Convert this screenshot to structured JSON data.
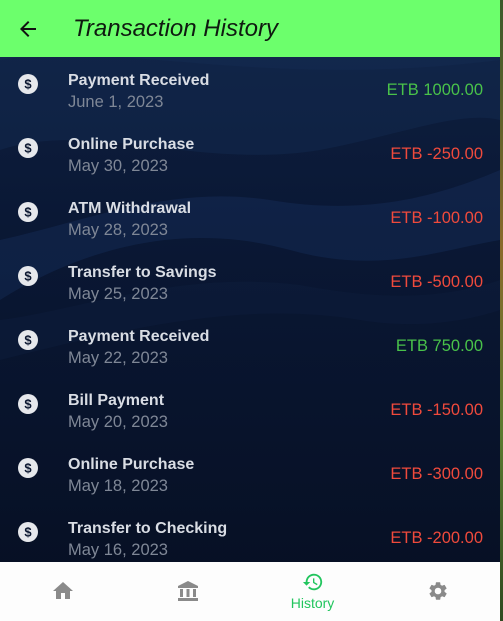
{
  "appbar": {
    "title": "Transaction History",
    "background": "#6cff6c",
    "back_icon": "arrow-back-icon"
  },
  "transactions": [
    {
      "title": "Payment Received",
      "date": "June 1, 2023",
      "amount": "ETB 1000.00",
      "type": "credit"
    },
    {
      "title": "Online Purchase",
      "date": "May 30, 2023",
      "amount": "ETB -250.00",
      "type": "debit"
    },
    {
      "title": "ATM Withdrawal",
      "date": "May 28, 2023",
      "amount": "ETB -100.00",
      "type": "debit"
    },
    {
      "title": "Transfer to Savings",
      "date": "May 25, 2023",
      "amount": "ETB -500.00",
      "type": "debit"
    },
    {
      "title": "Payment Received",
      "date": "May 22, 2023",
      "amount": "ETB 750.00",
      "type": "credit"
    },
    {
      "title": "Bill Payment",
      "date": "May 20, 2023",
      "amount": "ETB -150.00",
      "type": "debit"
    },
    {
      "title": "Online Purchase",
      "date": "May 18, 2023",
      "amount": "ETB -300.00",
      "type": "debit"
    },
    {
      "title": "Transfer to Checking",
      "date": "May 16, 2023",
      "amount": "ETB -200.00",
      "type": "debit"
    }
  ],
  "row_icon": "dollar-circle-icon",
  "colors": {
    "credit": "#49c24a",
    "debit": "#f04a3c",
    "nav_active": "#22c55e",
    "nav_inactive": "#8a8a8a"
  },
  "bottom_nav": {
    "items": [
      {
        "icon": "home-icon",
        "label": "",
        "active": false
      },
      {
        "icon": "bank-icon",
        "label": "",
        "active": false
      },
      {
        "icon": "history-icon",
        "label": "History",
        "active": true
      },
      {
        "icon": "settings-icon",
        "label": "",
        "active": false
      }
    ]
  }
}
